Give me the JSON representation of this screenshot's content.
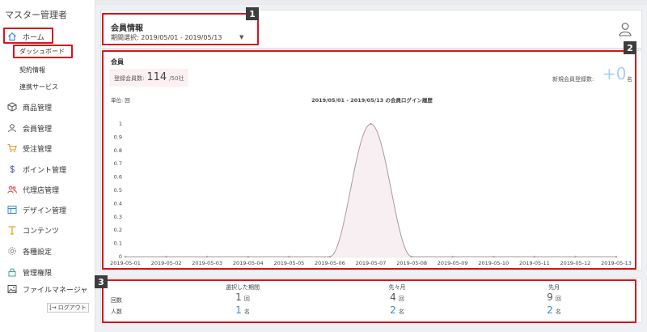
{
  "sidebar": {
    "title": "マスター管理者",
    "items": [
      {
        "label": "ホーム",
        "icon": "home-icon"
      },
      {
        "label": "商品管理",
        "icon": "box-icon"
      },
      {
        "label": "会員管理",
        "icon": "person-icon"
      },
      {
        "label": "受注管理",
        "icon": "cart-icon"
      },
      {
        "label": "ポイント管理",
        "icon": "dollar-icon"
      },
      {
        "label": "代理店管理",
        "icon": "users-icon"
      },
      {
        "label": "デザイン管理",
        "icon": "layout-icon"
      },
      {
        "label": "コンテンツ",
        "icon": "text-icon"
      },
      {
        "label": "各種設定",
        "icon": "gear-icon"
      },
      {
        "label": "管理権限",
        "icon": "lock-icon"
      },
      {
        "label": "ファイルマネージャ",
        "icon": "image-icon"
      }
    ],
    "subitems": [
      "ダッシュボード",
      "契約情報",
      "連携サービス"
    ],
    "logout": "ログアウト"
  },
  "colors": {
    "accent_red": "#d9141a",
    "cart_orange": "#f08a24",
    "users_red": "#e0443f",
    "blue_value": "#3a8fc8",
    "green_lock": "#3aa57a"
  },
  "member_info": {
    "title": "会員情報",
    "period": "期間選択: 2019/05/01 - 2019/05/13"
  },
  "member": {
    "title": "会員",
    "registered_label": "登録会員数:",
    "registered_count": "114",
    "registered_max": "/50社",
    "new_label": "新規会員登録数:",
    "new_count": "+0",
    "new_unit": "名"
  },
  "chart_data": {
    "type": "area",
    "title": "2019/05/01 - 2019/05/13 の会員ログイン履歴",
    "ylabel": "単位: 回",
    "ylim": [
      0,
      1
    ],
    "yticks": [
      "0",
      "0.1",
      "0.2",
      "0.3",
      "0.4",
      "0.5",
      "0.6",
      "0.7",
      "0.8",
      "0.9",
      "1"
    ],
    "categories": [
      "2019-05-01",
      "2019-05-02",
      "2019-05-03",
      "2019-05-04",
      "2019-05-05",
      "2019-05-06",
      "2019-05-07",
      "2019-05-08",
      "2019-05-09",
      "2019-05-10",
      "2019-05-11",
      "2019-05-12",
      "2019-05-13"
    ],
    "values": [
      0,
      0,
      0,
      0,
      0,
      0,
      1,
      0,
      0,
      0,
      0,
      0,
      0
    ]
  },
  "stats": {
    "row_labels": [
      "回数",
      "人数"
    ],
    "columns": [
      {
        "header": "選択した期間",
        "count": "1",
        "count_unit": "回",
        "people": "1",
        "people_unit": "名"
      },
      {
        "header": "先々月",
        "count": "4",
        "count_unit": "回",
        "people": "2",
        "people_unit": "名"
      },
      {
        "header": "先月",
        "count": "9",
        "count_unit": "回",
        "people": "2",
        "people_unit": "名"
      }
    ]
  },
  "badges": [
    "1",
    "2",
    "3"
  ]
}
